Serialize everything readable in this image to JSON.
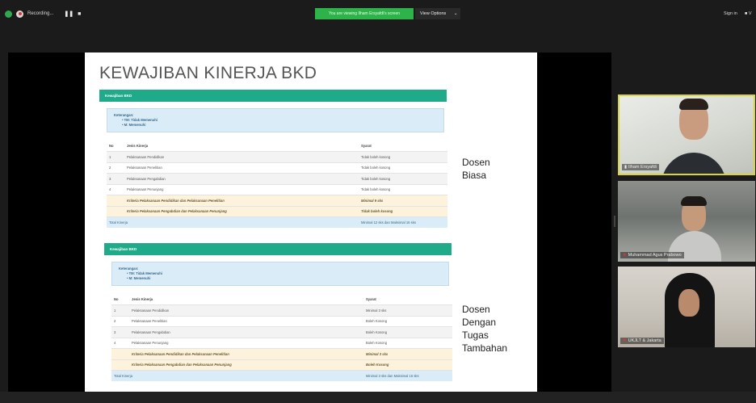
{
  "topbar": {
    "recording_label": "Recording...",
    "pause_symbol": "❚❚",
    "stop_symbol": "■",
    "viewing_banner": "You are viewing Ilham Ersyafdi's screen",
    "view_options_label": "View Options",
    "view_options_chevron": "⌄",
    "sign_in_label": "Sign in",
    "right_chip": "■ V"
  },
  "slide": {
    "title": "KEWAJIBAN KINERJA BKD",
    "panels": [
      {
        "header": "Kewajiban BKD",
        "keterangan_title": "Keterangan:",
        "keterangan_items": [
          "• TM: Tidak Memenuhi",
          "• M: Memenuhi"
        ],
        "columns": [
          "No",
          "Jenis Kinerja",
          "Syarat"
        ],
        "rows": [
          {
            "no": "1",
            "jenis": "Pelaksanaan Pendidikan",
            "syarat": "Tidak boleh kosong"
          },
          {
            "no": "2",
            "jenis": "Pelaksanaan Penelitian",
            "syarat": "Tidak boleh kosong"
          },
          {
            "no": "3",
            "jenis": "Pelaksanaan Pengabdian",
            "syarat": "Tidak boleh kosong"
          },
          {
            "no": "4",
            "jenis": "Pelaksanaan Penunjang",
            "syarat": "Tidak boleh kosong"
          }
        ],
        "criteria": [
          {
            "jenis": "Kriteria Pelaksanaan Pendidikan dan Pelaksanaan Penelitian",
            "syarat": "Minimal 9 sks"
          },
          {
            "jenis": "Kriteria Pelaksanaan Pengabdian dan Pelaksanaan Penunjang",
            "syarat": "Tidak boleh kosong"
          }
        ],
        "total_label": "Total Kinerja",
        "total_value": "Minimal 12 sks dan Maksimal 16 sks",
        "side_label": [
          "Dosen",
          "Biasa"
        ]
      },
      {
        "header": "Kewajiban BKD",
        "keterangan_title": "Keterangan:",
        "keterangan_items": [
          "• TM: Tidak Memenuhi",
          "• M: Memenuhi"
        ],
        "columns": [
          "No",
          "Jenis Kinerja",
          "Syarat"
        ],
        "rows": [
          {
            "no": "1",
            "jenis": "Pelaksanaan Pendidikan",
            "syarat": "Minimal 3 sks"
          },
          {
            "no": "2",
            "jenis": "Pelaksanaan Penelitian",
            "syarat": "Boleh Kosong"
          },
          {
            "no": "3",
            "jenis": "Pelaksanaan Pengabdian",
            "syarat": "Boleh Kosong"
          },
          {
            "no": "4",
            "jenis": "Pelaksanaan Penunjang",
            "syarat": "Boleh Kosong"
          }
        ],
        "criteria": [
          {
            "jenis": "Kriteria Pelaksanaan Pendidikan dan Pelaksanaan Penelitian",
            "syarat": "Minimal 3 sks"
          },
          {
            "jenis": "Kriteria Pelaksanaan Pengabdian dan Pelaksanaan Penunjang",
            "syarat": "Boleh Kosong"
          }
        ],
        "total_label": "Total Kinerja",
        "total_value": "Minimal 3 sks dan Maksimal 16 sks",
        "side_label": [
          "Dosen",
          "Dengan",
          "Tugas",
          "Tambahan"
        ]
      }
    ]
  },
  "participants": [
    {
      "name": "Ilham Ersyafdi",
      "muted": false,
      "active": true
    },
    {
      "name": "Muhammad Agus Prabowo",
      "muted": true,
      "active": false
    },
    {
      "name": "UKJLT & Jakarta",
      "muted": true,
      "active": false
    }
  ],
  "colors": {
    "zoom_green": "#2eb34a",
    "panel_green": "#1fab89",
    "active_speaker": "#d9d534",
    "slide_bottom_green": "#70b244"
  }
}
